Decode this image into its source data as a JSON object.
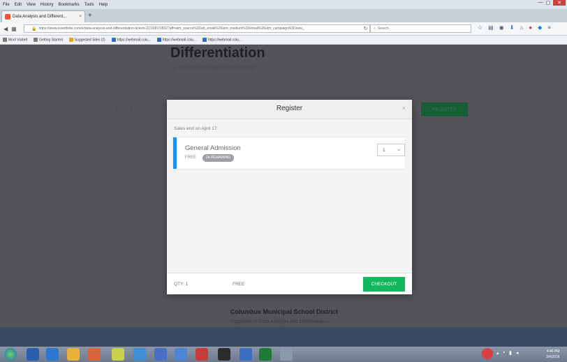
{
  "browser": {
    "menu": [
      "File",
      "Edit",
      "View",
      "History",
      "Bookmarks",
      "Tools",
      "Help"
    ],
    "tab_title": "Data Analysis and Different...",
    "tab_close": "×",
    "new_tab": "+",
    "url": "https://www.eventbrite.com/e/data-analysis-and-differentiation-tickets-22169570832?aff=utm_source%3Deb_email%26utm_medium%3Demail%26utm_campaign%3Dnew_",
    "search_placeholder": "Search",
    "bookmarks": [
      "Most Visited",
      "Getting Started",
      "Suggested Sites (2)",
      "https://webmail.colu...",
      "https://webmail.colu...",
      "https://webmail.colu..."
    ]
  },
  "page": {
    "title": "Differentiation",
    "byline": "by Columbus Municipal School District",
    "register_label": "REGISTER",
    "organizer_name": "Columbus Municipal School District",
    "organizer_sub": "Organizer of Data Analysis and Differentiation"
  },
  "modal": {
    "title": "Register",
    "close": "×",
    "sales_end": "Sales end on April 17",
    "ticket": {
      "name": "General Admission",
      "price": "FREE",
      "remaining": "24 REMAINING",
      "quantity": "1"
    },
    "footer": {
      "qty": "QTY: 1",
      "total": "FREE",
      "checkout_label": "CHECKOUT"
    }
  },
  "taskbar": {
    "clock_time": "4:46 PM",
    "clock_date": "3/4/2016"
  },
  "colors": {
    "accent_blue": "#1f8ee8",
    "checkout_green": "#14b85c",
    "overlay": "#535358"
  }
}
